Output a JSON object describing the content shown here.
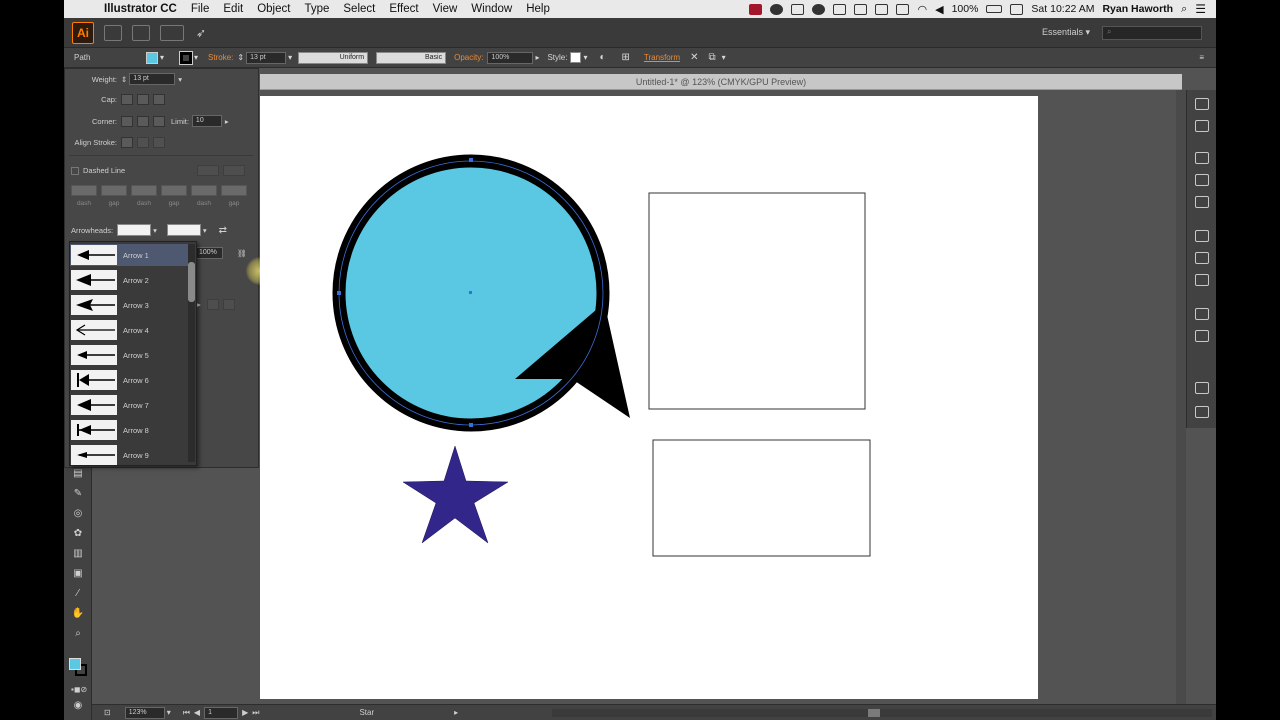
{
  "menubar": {
    "app_name": "Illustrator CC",
    "menus": [
      "File",
      "Edit",
      "Object",
      "Type",
      "Select",
      "Effect",
      "View",
      "Window",
      "Help"
    ],
    "battery": "100%",
    "clock": "Sat 10:22 AM",
    "user": "Ryan Haworth"
  },
  "appbar": {
    "logo": "Ai",
    "workspace": "Essentials"
  },
  "control_bar": {
    "selection_label": "Path",
    "stroke_label": "Stroke:",
    "stroke_value": "13 pt",
    "profile_value": "Uniform",
    "brush_value": "Basic",
    "opacity_label": "Opacity:",
    "opacity_value": "100%",
    "style_label": "Style:",
    "transform_label": "Transform",
    "fill_color": "#5bc8e3"
  },
  "stroke_panel": {
    "weight_label": "Weight:",
    "weight_value": "13 pt",
    "cap_label": "Cap:",
    "corner_label": "Corner:",
    "limit_label": "Limit:",
    "limit_value": "10",
    "align_label": "Align Stroke:",
    "dashed_label": "Dashed Line",
    "dash_labels": [
      "dash",
      "gap",
      "dash",
      "gap",
      "dash",
      "gap"
    ],
    "arrowheads_label": "Arrowheads:",
    "scale_value": "100%"
  },
  "arrow_options": [
    "Arrow 1",
    "Arrow 2",
    "Arrow 3",
    "Arrow 4",
    "Arrow 5",
    "Arrow 6",
    "Arrow 7",
    "Arrow 8",
    "Arrow 9"
  ],
  "arrow_selected": "Arrow 1",
  "document": {
    "tab_title": "Untitled-1* @ 123% (CMYK/GPU Preview)"
  },
  "artwork": {
    "circle_fill": "#5bc8e3",
    "star_fill": "#33268a",
    "stroke_color": "#000000"
  },
  "status_bar": {
    "zoom": "123%",
    "page": "1",
    "tool": "Star"
  }
}
